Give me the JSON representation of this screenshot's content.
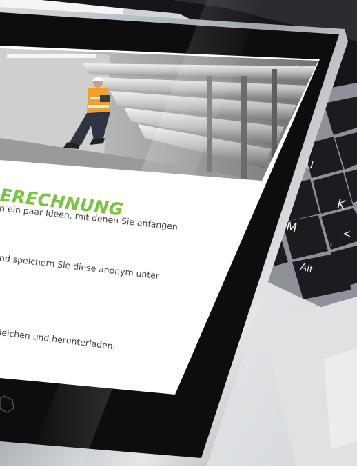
{
  "photo": {
    "subject": "worker-in-pipe-tunnel"
  },
  "screen": {
    "headline": "ERECHNUNG",
    "paragraph_1": "n ein paar Ideen, mit denen Sie anfangen",
    "paragraph_2": "nd speichern Sie diese anonym unter",
    "paragraph_3": "leichen und herunterladen."
  },
  "keyboard": {
    "alt_key": "Alt",
    "m_key": "M",
    "k_key": "K",
    "u_key": "U",
    "comma_key": ",",
    "lt_key": "<"
  },
  "colors": {
    "accent_green": "#7ac33f",
    "tablet_frame": "#b9bec4",
    "bezel": "#0d0d0f",
    "key": "#1b1c1f"
  },
  "icons": {
    "menu": "hamburger-icon",
    "home_button": "hexagon-icon"
  }
}
